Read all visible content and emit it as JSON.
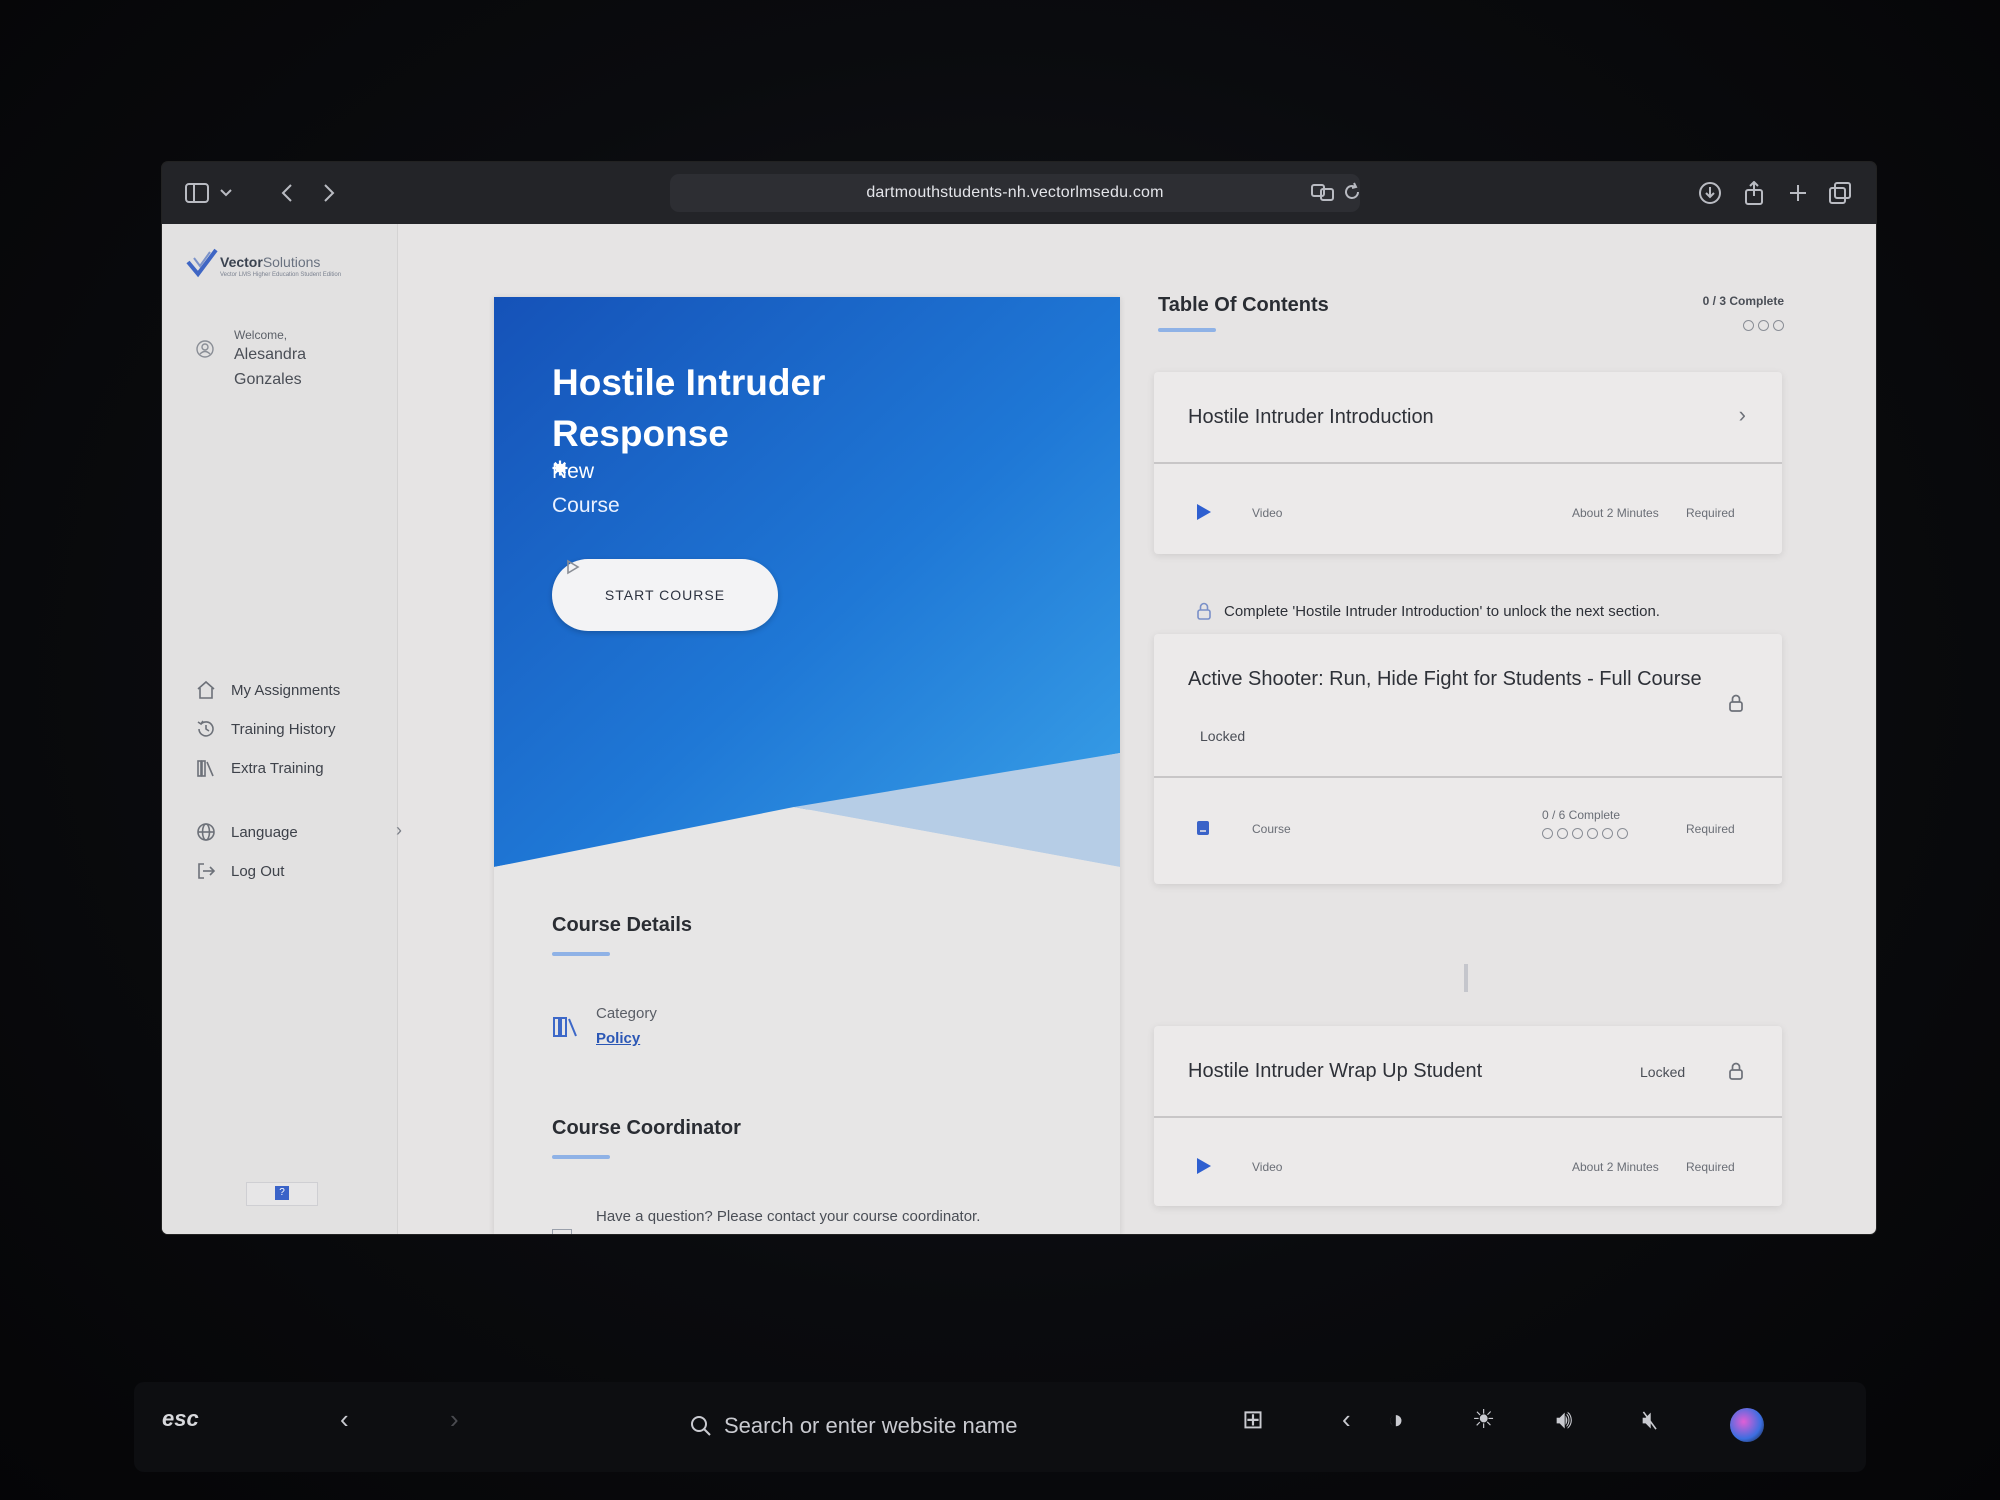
{
  "browser": {
    "url": "dartmouthstudents-nh.vectorlmsedu.com"
  },
  "sidebar": {
    "logo_name": "Vector",
    "logo_name_light": "Solutions",
    "logo_sub": "Vector LMS Higher Education Student Edition",
    "welcome_label": "Welcome,",
    "user_name": "Alesandra Gonzales",
    "nav": [
      {
        "label": "My Assignments"
      },
      {
        "label": "Training History"
      },
      {
        "label": "Extra Training"
      },
      {
        "label": "Language"
      },
      {
        "label": "Log Out"
      }
    ],
    "help_label": "?"
  },
  "course": {
    "title": "Hostile Intruder Response",
    "badge": "New",
    "type": "Course",
    "start_label": "START COURSE",
    "details_heading": "Course Details",
    "category_label": "Category",
    "category_value": "Policy",
    "coordinator_heading": "Course Coordinator",
    "coordinator_text": "Have a question? Please contact your course coordinator."
  },
  "toc": {
    "title": "Table Of Contents",
    "progress": "0 / 3 Complete",
    "progress_done": 0,
    "progress_total": 3,
    "items": [
      {
        "title": "Hostile Intruder Introduction",
        "kind": "Video",
        "duration": "About 2 Minutes",
        "requirement": "Required"
      },
      {
        "title": "Active Shooter: Run, Hide Fight for Students - Full Course",
        "status": "Locked",
        "kind": "Course",
        "progress": "0 / 6 Complete",
        "progress_done": 0,
        "progress_total": 6,
        "requirement": "Required"
      },
      {
        "title": "Hostile Intruder Wrap Up Student",
        "status": "Locked",
        "kind": "Video",
        "duration": "About 2 Minutes",
        "requirement": "Required"
      }
    ],
    "unlock_note": "Complete 'Hostile Intruder Introduction' to unlock the next section."
  },
  "touchbar": {
    "esc": "esc",
    "search_placeholder": "Search or enter website name"
  },
  "colors": {
    "hero_blue": "#1b5fc4",
    "accent_underline": "#8fb2e6",
    "link": "#2b57b5"
  }
}
